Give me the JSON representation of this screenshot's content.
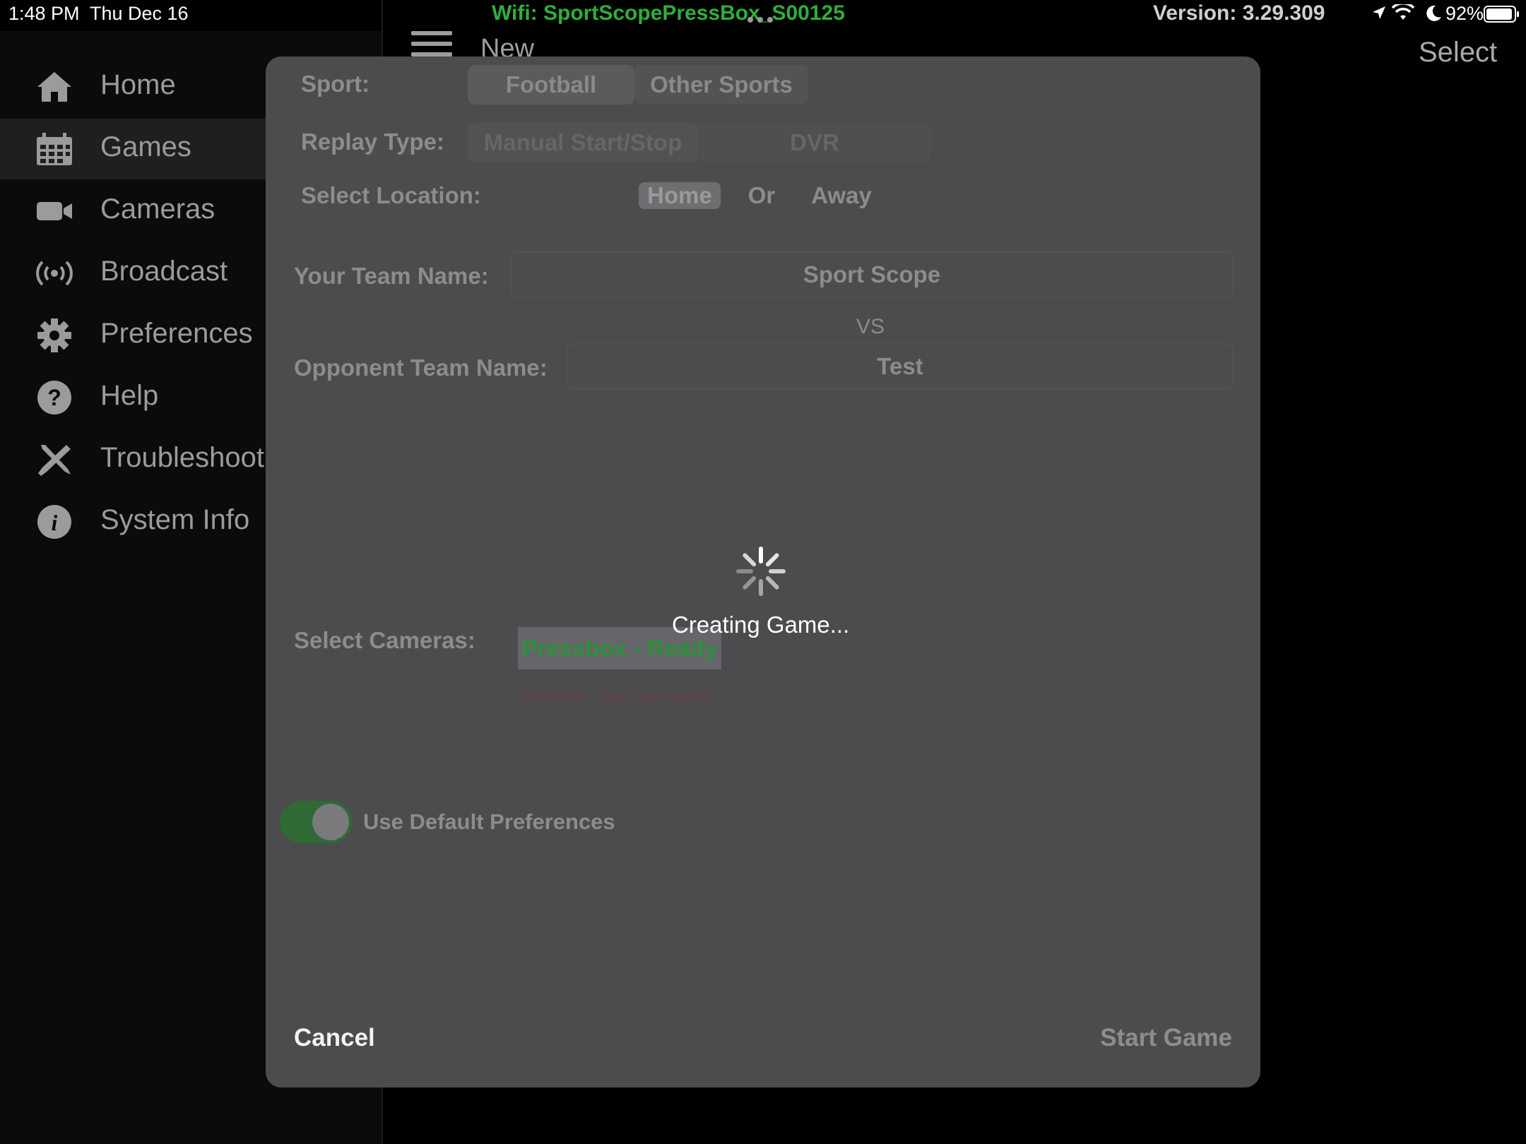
{
  "status_bar": {
    "time": "1:48 PM",
    "date": "Thu Dec 16",
    "wifi": "Wifi: SportScopePressBox_S00125",
    "version": "Version: 3.29.309",
    "battery": "92%",
    "wifi_color": "#2fae3a"
  },
  "sidebar": {
    "items": [
      {
        "label": "Home",
        "icon": "home-icon"
      },
      {
        "label": "Games",
        "icon": "calendar-icon"
      },
      {
        "label": "Cameras",
        "icon": "video-camera-icon"
      },
      {
        "label": "Broadcast",
        "icon": "broadcast-icon"
      },
      {
        "label": "Preferences",
        "icon": "gear-icon"
      },
      {
        "label": "Help",
        "icon": "help-icon"
      },
      {
        "label": "Troubleshoot",
        "icon": "tools-icon"
      },
      {
        "label": "System Info",
        "icon": "info-icon"
      }
    ],
    "active": "Games"
  },
  "header": {
    "title": "New",
    "select_label": "Select"
  },
  "modal": {
    "sport_label": "Sport:",
    "sport_options": [
      "Football",
      "Other Sports"
    ],
    "sport_selected": "Football",
    "replay_label": "Replay Type:",
    "replay_options": [
      "Manual Start/Stop",
      "DVR"
    ],
    "replay_selected": "Manual Start/Stop",
    "location_label": "Select Location:",
    "location_home": "Home",
    "location_or": "Or",
    "location_away": "Away",
    "team_label": "Your Team Name:",
    "team_value": "Sport Scope",
    "vs": "VS",
    "opponent_label": "Opponent Team Name:",
    "opponent_value": "Test",
    "cameras_label": "Select Cameras:",
    "camera_ready": "Pressbox - Ready",
    "camera_not_connected": "Endzone - Not Connected",
    "default_prefs_label": "Use Default Preferences",
    "default_prefs_on": true,
    "cancel": "Cancel",
    "start": "Start Game"
  },
  "loading": {
    "text": "Creating Game..."
  }
}
